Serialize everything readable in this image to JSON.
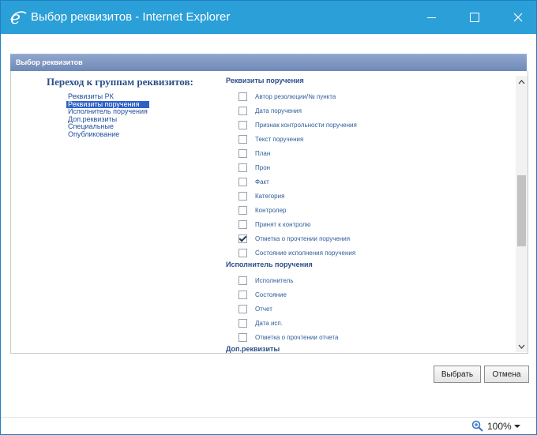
{
  "window": {
    "title": "Выбор реквизитов - Internet Explorer"
  },
  "panel": {
    "title": "Выбор реквизитов"
  },
  "nav": {
    "heading": "Переход к группам реквизитов:",
    "items": [
      {
        "label": "Реквизиты РК",
        "active": false
      },
      {
        "label": "Реквизиты поручения",
        "active": true
      },
      {
        "label": "Исполнитель поручения",
        "active": false
      },
      {
        "label": "Доп.реквизиты",
        "active": false
      },
      {
        "label": "Специальные",
        "active": false
      },
      {
        "label": "Опубликование",
        "active": false
      }
    ]
  },
  "groups": [
    {
      "title": "Реквизиты поручения",
      "fields": [
        {
          "label": "Автор резолюции/№ пункта",
          "checked": false
        },
        {
          "label": "Дата поручения",
          "checked": false
        },
        {
          "label": "Признак контрольности поручения",
          "checked": false
        },
        {
          "label": "Текст поручения",
          "checked": false
        },
        {
          "label": "План",
          "checked": false
        },
        {
          "label": "Прон",
          "checked": false
        },
        {
          "label": "Факт",
          "checked": false
        },
        {
          "label": "Категория",
          "checked": false
        },
        {
          "label": "Контролер",
          "checked": false
        },
        {
          "label": "Принят к контролю",
          "checked": false
        },
        {
          "label": "Отметка о прочтении поручения",
          "checked": true
        },
        {
          "label": "Состояние исполнения поручения",
          "checked": false
        }
      ]
    },
    {
      "title": "Исполнитель поручения",
      "fields": [
        {
          "label": "Исполнитель",
          "checked": false
        },
        {
          "label": "Состояние",
          "checked": false
        },
        {
          "label": "Отчет",
          "checked": false
        },
        {
          "label": "Дата исп.",
          "checked": false
        },
        {
          "label": "Отметка о прочтении отчета",
          "checked": false
        }
      ]
    },
    {
      "title": "Доп.реквизиты",
      "fields": [
        {
          "label": "",
          "checked": false
        }
      ]
    }
  ],
  "buttons": {
    "select": "Выбрать",
    "cancel": "Отмена"
  },
  "status": {
    "zoom": "100%"
  },
  "colors": {
    "titlebar": "#2b9fd8",
    "panel_header": "#7a92c0",
    "link": "#1f4f9a",
    "active": "#2e61c6"
  },
  "icons": [
    "ie-icon",
    "minimize-icon",
    "maximize-icon",
    "close-icon",
    "scroll-up-icon",
    "scroll-down-icon",
    "zoom-icon",
    "dropdown-arrow-icon"
  ]
}
